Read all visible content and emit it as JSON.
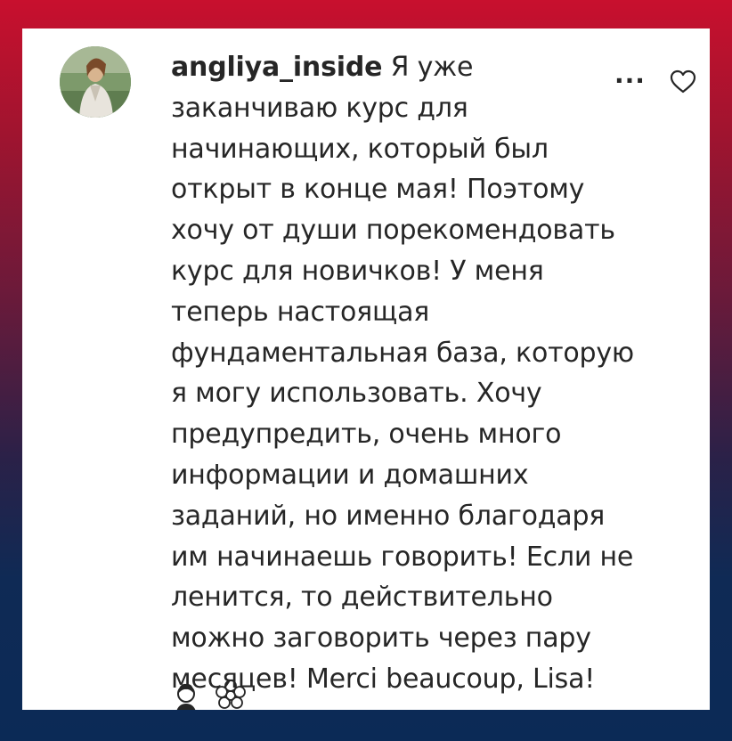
{
  "comment": {
    "username": "angliya_inside",
    "text": "Я уже заканчиваю курс для начинающих, который был открыт в конце мая! Поэтому хочу от души порекомендовать курс для новичков! У меня теперь настоящая фундаментальная база, которую я могу использовать. Хочу предупредить, очень много информации и домашних заданий, но именно благодаря им начинаешь говорить! Если не ленится, то действительно можно заговорить через пару месяцев! Merci beaucoup, Lisa!",
    "more_label": "...",
    "icons": {
      "avatar": "user-avatar-photo",
      "like": "heart-outline-icon",
      "emoji_1": "woman-emoji-icon",
      "emoji_2": "blossom-emoji-icon"
    }
  },
  "colors": {
    "text": "#262626",
    "card_bg": "#ffffff",
    "frame_top": "#c8102e",
    "frame_bottom": "#0b2a56"
  }
}
